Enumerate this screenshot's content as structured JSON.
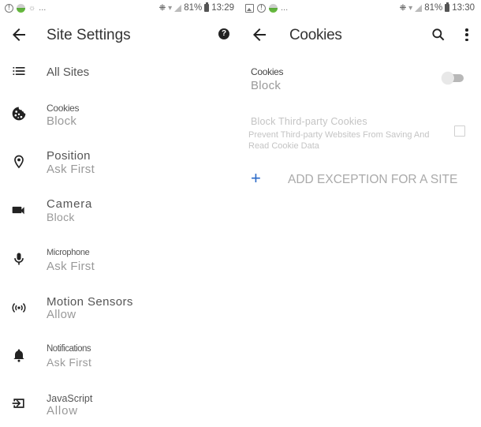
{
  "left_screen": {
    "status_bar": {
      "left_icons": [
        "alert-icon",
        "app-ball-icon",
        "sync-icon"
      ],
      "overflow": "...",
      "right_icons": [
        "mute-icon",
        "wifi-icon",
        "signal-icon"
      ],
      "battery_percent": "81%",
      "time": "13:29"
    },
    "app_bar": {
      "back_icon": "arrow-left-icon",
      "title": "Site Settings",
      "help_icon": "help-icon",
      "help_glyph": "?"
    },
    "items": [
      {
        "icon": "list-icon",
        "title": "All Sites",
        "subtitle": ""
      },
      {
        "icon": "cookie-icon",
        "title": "Cookies",
        "subtitle": "Block"
      },
      {
        "icon": "location-pin-icon",
        "title": "Position",
        "subtitle": "Ask First"
      },
      {
        "icon": "camera-icon",
        "title": "Camera",
        "subtitle": "Block"
      },
      {
        "icon": "microphone-icon",
        "title": "Microphone",
        "subtitle": "Ask First"
      },
      {
        "icon": "motion-sensors-icon",
        "title": "Motion Sensors",
        "subtitle": "Allow"
      },
      {
        "icon": "bell-icon",
        "title": "Notifications",
        "subtitle": "Ask First"
      },
      {
        "icon": "javascript-icon",
        "title": "JavaScript",
        "subtitle": "Allow"
      }
    ]
  },
  "right_screen": {
    "status_bar": {
      "left_icons": [
        "image-icon",
        "alert-icon",
        "app-ball-icon"
      ],
      "overflow": "...",
      "right_icons": [
        "mute-icon",
        "wifi-icon",
        "signal-icon"
      ],
      "battery_percent": "81%",
      "time": "13:30"
    },
    "app_bar": {
      "back_icon": "arrow-left-icon",
      "title": "Cookies",
      "search_icon": "search-icon",
      "more_icon": "more-vert-icon"
    },
    "cookies_setting": {
      "label": "Cookies",
      "value": "Block",
      "toggle_on": false
    },
    "third_party": {
      "title": "Block Third-party Cookies",
      "description": "Prevent Third-party Websites From Saving And Read Cookie Data",
      "checked": false,
      "enabled": false
    },
    "add_exception": {
      "icon": "plus-icon",
      "plus_glyph": "+",
      "label": "ADD EXCEPTION FOR A SITE"
    },
    "colors": {
      "accent": "#2a6ac8",
      "disabled_text": "#c4c4c4"
    }
  }
}
